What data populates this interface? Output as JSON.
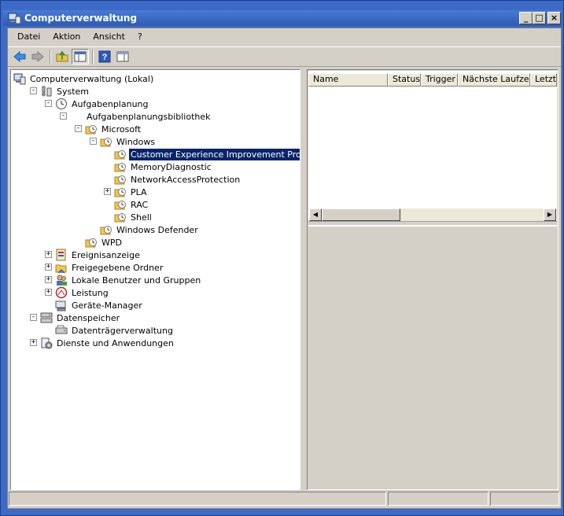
{
  "window": {
    "title": "Computerverwaltung",
    "buttons": [
      "_",
      "□",
      "×"
    ]
  },
  "menubar": [
    "Datei",
    "Aktion",
    "Ansicht",
    "?"
  ],
  "toolbar": {
    "icons": [
      "back-arrow-icon",
      "forward-arrow-icon",
      "up-folder-icon",
      "show-hide-console-tree-icon",
      "help-icon",
      "action-pane-icon"
    ]
  },
  "tree": [
    {
      "label": "Computerverwaltung (Lokal)",
      "icon": "computer-management-icon",
      "level": 0,
      "expander": ""
    },
    {
      "label": "System",
      "icon": "system-tools-icon",
      "level": 1,
      "expander": "−"
    },
    {
      "label": "Aufgabenplanung",
      "icon": "clock-icon",
      "level": 2,
      "expander": "−"
    },
    {
      "label": "Aufgabenplanungsbibliothek",
      "icon": "folder-icon",
      "level": 3,
      "expander": "−"
    },
    {
      "label": "Microsoft",
      "icon": "task-folder-icon",
      "level": 4,
      "expander": "−"
    },
    {
      "label": "Windows",
      "icon": "task-folder-icon",
      "level": 5,
      "expander": "−"
    },
    {
      "label": "Customer Experience Improvement Program",
      "icon": "task-folder-icon",
      "level": 6,
      "expander": "",
      "selected": true
    },
    {
      "label": "MemoryDiagnostic",
      "icon": "task-folder-icon",
      "level": 6,
      "expander": ""
    },
    {
      "label": "NetworkAccessProtection",
      "icon": "task-folder-icon",
      "level": 6,
      "expander": ""
    },
    {
      "label": "PLA",
      "icon": "task-folder-icon",
      "level": 6,
      "expander": "+"
    },
    {
      "label": "RAC",
      "icon": "task-folder-icon",
      "level": 6,
      "expander": ""
    },
    {
      "label": "Shell",
      "icon": "task-folder-icon",
      "level": 6,
      "expander": ""
    },
    {
      "label": "Windows Defender",
      "icon": "task-folder-icon",
      "level": 5,
      "expander": ""
    },
    {
      "label": "WPD",
      "icon": "task-folder-icon",
      "level": 4,
      "expander": ""
    },
    {
      "label": "Ereignisanzeige",
      "icon": "event-viewer-icon",
      "level": 2,
      "expander": "+"
    },
    {
      "label": "Freigegebene Ordner",
      "icon": "shared-folders-icon",
      "level": 2,
      "expander": "+"
    },
    {
      "label": "Lokale Benutzer und Gruppen",
      "icon": "users-groups-icon",
      "level": 2,
      "expander": "+"
    },
    {
      "label": "Leistung",
      "icon": "performance-icon",
      "level": 2,
      "expander": "+"
    },
    {
      "label": "Geräte-Manager",
      "icon": "device-manager-icon",
      "level": 2,
      "expander": ""
    },
    {
      "label": "Datenspeicher",
      "icon": "storage-icon",
      "level": 1,
      "expander": "−"
    },
    {
      "label": "Datenträgerverwaltung",
      "icon": "disk-management-icon",
      "level": 2,
      "expander": ""
    },
    {
      "label": "Dienste und Anwendungen",
      "icon": "services-icon",
      "level": 1,
      "expander": "+"
    }
  ],
  "listview": {
    "columns": [
      "Name",
      "Status",
      "Trigger",
      "Nächste Laufzeit",
      "Letzte"
    ]
  },
  "colors": {
    "titlebar": "#2d5bb5",
    "selection": "#0a246a",
    "frame": "#3c6ac6",
    "face": "#d4d0c8"
  }
}
